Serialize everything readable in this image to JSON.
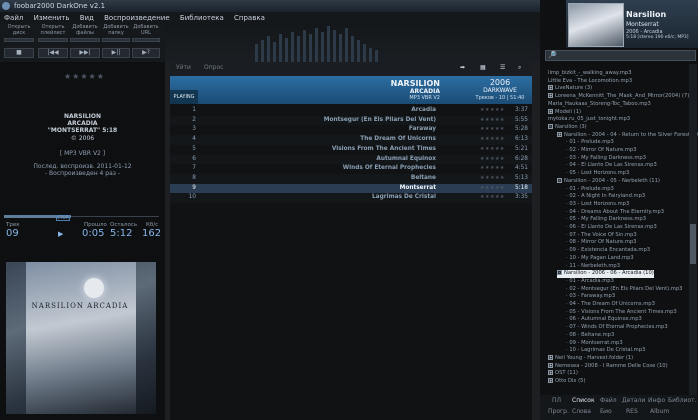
{
  "window": {
    "title": "foobar2000 DarkOne v2.1"
  },
  "menu": [
    "Файл",
    "Изменить",
    "Вид",
    "Воспроизведение",
    "Библиотека",
    "Справка"
  ],
  "toolbar": {
    "buttons": [
      "Открыть диск",
      "Открыть плейлист",
      "Добавить файлы",
      "Добавить папку",
      "Добавить URL"
    ]
  },
  "transport": {
    "stop": "■",
    "prev": "|◀◀",
    "next": "▶▶|",
    "pause": "▶||",
    "random": "▶?"
  },
  "nowplaying_info": {
    "artist": "NARSILION",
    "album": "ARCADIA",
    "track": "\"MONTSERRAT\" 5:18",
    "year": "© 2006",
    "format": "[ MP3 VBR V2 ]",
    "last_played": "Послед. воспроизв. 2011-01-12",
    "play_count": "- Воспроизведен 4 раз -",
    "rating_stars": "★★★★★"
  },
  "seekbar": {
    "label": "СТОП",
    "progress": 0.43
  },
  "stats": {
    "track_label": "Трек",
    "track_value": "09",
    "elapsed_label": "Прошло",
    "elapsed_value": "0:05",
    "remaining_label": "Осталось",
    "remaining_value": "5:12",
    "bitrate_label": "Кб/с",
    "bitrate_value": "162"
  },
  "cover": {
    "title": "NARSILION ARCADIA"
  },
  "mid_tabs": [
    "Уйти",
    "Опрос"
  ],
  "album_header": {
    "artist": "NARSILION",
    "album": "ARCADIA",
    "format": "MP3 VBR V2",
    "year": "2006",
    "genre": "DARKWAVE",
    "summary": "Треков - 10  |  51:40",
    "playing_label": "PLAYING"
  },
  "tracks": [
    {
      "n": "1",
      "title": "Arcadia",
      "dur": "3:37"
    },
    {
      "n": "2",
      "title": "Montsegur (En Els Pilars Del Vent)",
      "dur": "5:55"
    },
    {
      "n": "3",
      "title": "Faraway",
      "dur": "5:28"
    },
    {
      "n": "4",
      "title": "The Dream Of Unicorns",
      "dur": "6:13"
    },
    {
      "n": "5",
      "title": "Visions From The Ancient Times",
      "dur": "5:21"
    },
    {
      "n": "6",
      "title": "Autumnal Equinox",
      "dur": "6:28"
    },
    {
      "n": "7",
      "title": "Winds Of Eternal Prophecies",
      "dur": "4:51"
    },
    {
      "n": "8",
      "title": "Beltane",
      "dur": "5:13"
    },
    {
      "n": "9",
      "title": "Montserrat",
      "dur": "5:18"
    },
    {
      "n": "10",
      "title": "Lagrimas De Cristal",
      "dur": "3:35"
    }
  ],
  "np_panel": {
    "artist": "Narsilion",
    "album": "Montserrat",
    "year_album": "2006 - Arcadia",
    "format": "5:18  [stereo 190 кб/с; MP3]"
  },
  "library_tree": [
    {
      "text": "limp_bizkit_-_walking_away.mp3",
      "lvl": 0,
      "box": ""
    },
    {
      "text": "Little Eva - The Locomotion.mp3",
      "lvl": 0,
      "box": ""
    },
    {
      "text": "LiveNature (3)",
      "lvl": 0,
      "box": "+"
    },
    {
      "text": "Loreena_McKennitt_The_Mask_And_Mirror(2004) (7)",
      "lvl": 0,
      "box": "+"
    },
    {
      "text": "Maria_Haukaas_Storeng-Toc_Taboo.mp3",
      "lvl": 0,
      "box": ""
    },
    {
      "text": "Modeli (1)",
      "lvl": 0,
      "box": "+"
    },
    {
      "text": "mytoka.ru_05_just_tonight.mp3",
      "lvl": 0,
      "box": ""
    },
    {
      "text": "Narsilion (3)",
      "lvl": 0,
      "box": "-"
    },
    {
      "text": "Narsilion - 2004 - 04 - Return to the Silver Forest (10)",
      "lvl": 1,
      "box": "+"
    },
    {
      "text": "01 - Prelude.mp3",
      "lvl": 2,
      "box": ""
    },
    {
      "text": "02 - Mirror Of Nature.mp3",
      "lvl": 2,
      "box": ""
    },
    {
      "text": "03 - My Falling Darkness.mp3",
      "lvl": 2,
      "box": ""
    },
    {
      "text": "04 - El Llanto De Las Sirenas.mp3",
      "lvl": 2,
      "box": ""
    },
    {
      "text": "05 - Lost Horizons.mp3",
      "lvl": 2,
      "box": ""
    },
    {
      "text": "Narsilion - 2004 - 05 - Nerbeleth (11)",
      "lvl": 1,
      "box": "-"
    },
    {
      "text": "01 - Prelude.mp3",
      "lvl": 2,
      "box": ""
    },
    {
      "text": "02 - A Night In Fairyland.mp3",
      "lvl": 2,
      "box": ""
    },
    {
      "text": "03 - Lost Horizons.mp3",
      "lvl": 2,
      "box": ""
    },
    {
      "text": "04 - Dreams About The Eternity.mp3",
      "lvl": 2,
      "box": ""
    },
    {
      "text": "05 - My Falling Darkness.mp3",
      "lvl": 2,
      "box": ""
    },
    {
      "text": "06 - El Llanto De Las Sirenas.mp3",
      "lvl": 2,
      "box": ""
    },
    {
      "text": "07 - The Voice Of Sin.mp3",
      "lvl": 2,
      "box": ""
    },
    {
      "text": "08 - Mirror Of Nature.mp3",
      "lvl": 2,
      "box": ""
    },
    {
      "text": "09 - Existencia Encantada.mp3",
      "lvl": 2,
      "box": ""
    },
    {
      "text": "10 - My Pagan Land.mp3",
      "lvl": 2,
      "box": ""
    },
    {
      "text": "11 - Nerbeleth.mp3",
      "lvl": 2,
      "box": ""
    },
    {
      "text": "Narsilion - 2006 - 06 - Arcadia (10)",
      "lvl": 1,
      "box": "-",
      "sel": true
    },
    {
      "text": "01 - Arcadia.mp3",
      "lvl": 2,
      "box": ""
    },
    {
      "text": "02 - Montsegur (En Els Pilars Del Vent).mp3",
      "lvl": 2,
      "box": ""
    },
    {
      "text": "03 - Faraway.mp3",
      "lvl": 2,
      "box": ""
    },
    {
      "text": "04 - The Dream Of Unicorns.mp3",
      "lvl": 2,
      "box": ""
    },
    {
      "text": "05 - Visions From The Ancient Times.mp3",
      "lvl": 2,
      "box": ""
    },
    {
      "text": "06 - Autumnal Equinox.mp3",
      "lvl": 2,
      "box": ""
    },
    {
      "text": "07 - Winds Of Eternal Prophecies.mp3",
      "lvl": 2,
      "box": ""
    },
    {
      "text": "08 - Beltane.mp3",
      "lvl": 2,
      "box": ""
    },
    {
      "text": "09 - Montserrat.mp3",
      "lvl": 2,
      "box": ""
    },
    {
      "text": "10 - Lagrimas De Cristal.mp3",
      "lvl": 2,
      "box": ""
    },
    {
      "text": "Neil Young - Harvest.folder (1)",
      "lvl": 0,
      "box": "+"
    },
    {
      "text": "Nemesea - 2008 - I Ramme Delle Cose (10)",
      "lvl": 0,
      "box": "+"
    },
    {
      "text": "OST (11)",
      "lvl": 0,
      "box": "+"
    },
    {
      "text": "Otto Dix (5)",
      "lvl": 0,
      "box": "+"
    }
  ],
  "bottom_tabs_1": [
    "ПЛ",
    "Список",
    "Файл",
    "Детали",
    "Инфо",
    "Библиот."
  ],
  "bottom_tabs_2": [
    "Прогр.",
    "Слова",
    "Био",
    "RES",
    "Album"
  ]
}
